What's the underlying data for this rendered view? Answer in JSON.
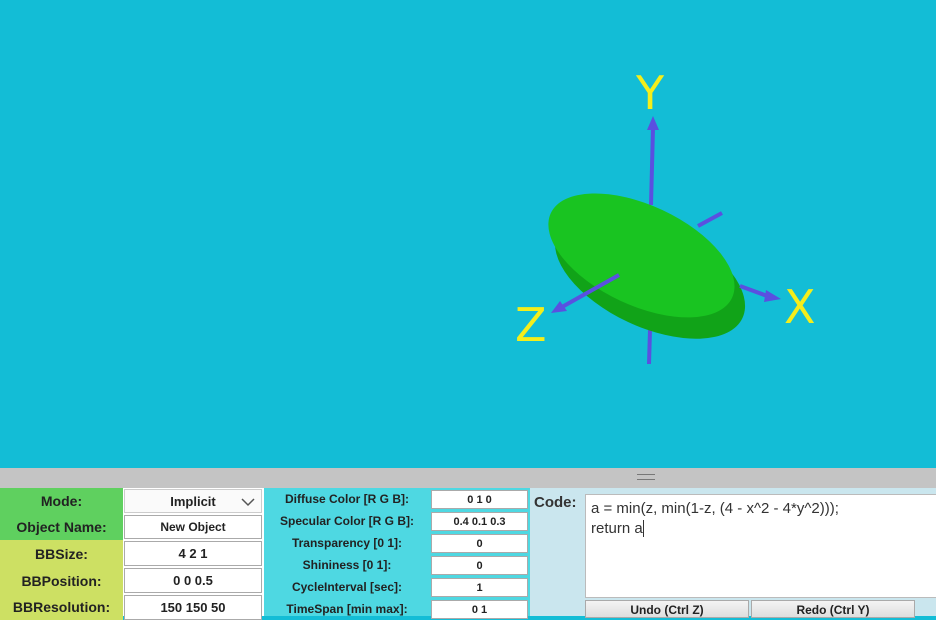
{
  "scene": {
    "axes": {
      "x_label": "X",
      "y_label": "Y",
      "z_label": "Z"
    },
    "colors": {
      "background": "#13bdd6",
      "axis": "#5a50e0",
      "label": "#f4ee1b",
      "object": "#16c01e"
    }
  },
  "panel": {
    "mode": {
      "label": "Mode:",
      "value": "Implicit"
    },
    "object_name": {
      "label": "Object Name:",
      "value": "New Object"
    },
    "bb_size": {
      "label": "BBSize:",
      "value": "4 2 1"
    },
    "bb_position": {
      "label": "BBPosition:",
      "value": "0 0 0.5"
    },
    "bb_resolution": {
      "label": "BBResolution:",
      "value": "150 150 50"
    },
    "diffuse": {
      "label": "Diffuse Color [R G B]:",
      "value": "0 1 0"
    },
    "specular": {
      "label": "Specular Color [R G B]:",
      "value": "0.4 0.1 0.3"
    },
    "transparency": {
      "label": "Transparency [0 1]:",
      "value": "0"
    },
    "shininess": {
      "label": "Shininess [0 1]:",
      "value": "0"
    },
    "cycle_interval": {
      "label": "CycleInterval [sec]:",
      "value": "1"
    },
    "time_span": {
      "label": "TimeSpan [min max]:",
      "value": "0 1"
    },
    "code": {
      "label": "Code:",
      "line1": "a = min(z, min(1-z, (4 - x^2 - 4*y^2)));",
      "line2": "return a"
    },
    "undo_label": "Undo (Ctrl Z)",
    "redo_label": "Redo (Ctrl Y)"
  }
}
